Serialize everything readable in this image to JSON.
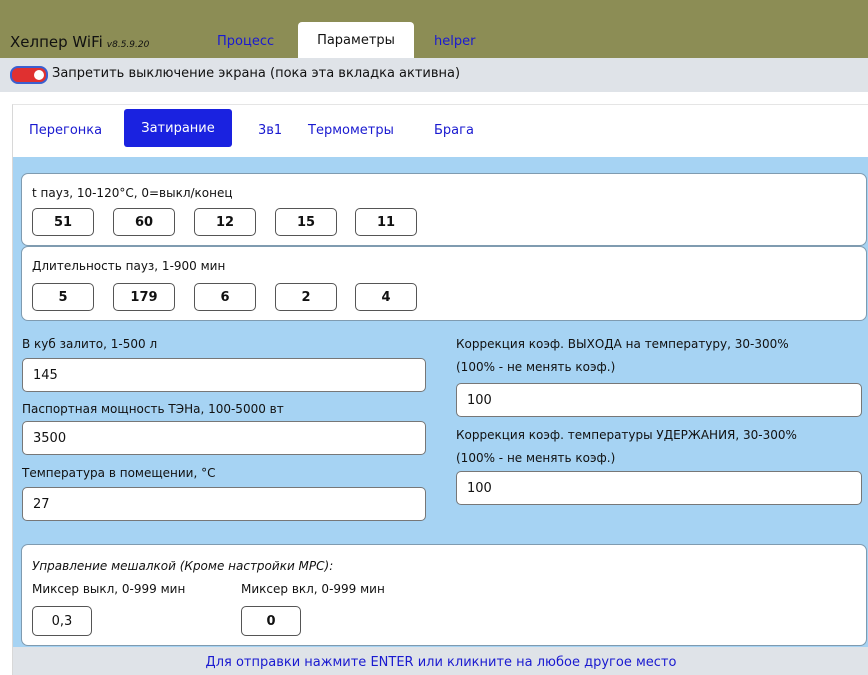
{
  "header": {
    "app_title": "Хелпер WiFi",
    "version": "v8.5.9.20",
    "tabs": [
      {
        "label": "Процесс"
      },
      {
        "label": "Параметры"
      },
      {
        "label": "helper"
      }
    ]
  },
  "screen_lock": {
    "label": "Запретить выключение экрана (пока эта вкладка активна)",
    "enabled": true
  },
  "sub_tabs": [
    {
      "label": "Перегонка"
    },
    {
      "label": "Затирание"
    },
    {
      "label": "3в1"
    },
    {
      "label": "Термометры"
    },
    {
      "label": "Брага"
    }
  ],
  "pause_temps": {
    "label": "t пауз, 10-120°С, 0=выкл/конец",
    "values": [
      "51",
      "60",
      "12",
      "15",
      "11"
    ]
  },
  "pause_durations": {
    "label": "Длительность пауз, 1-900 мин",
    "values": [
      "5",
      "179",
      "6",
      "2",
      "4"
    ]
  },
  "fields": {
    "volume_label": "В куб залито, 1-500 л",
    "volume_value": "145",
    "power_label": "Паспортная мощность ТЭНа, 100-5000 вт",
    "power_value": "3500",
    "room_temp_label": "Температура в помещении, °С",
    "room_temp_value": "27",
    "exit_coef_label_1": "Коррекция коэф. ВЫХОДА на температуру, 30-300%",
    "exit_coef_label_2": "(100% - не менять коэф.)",
    "exit_coef_value": "100",
    "hold_coef_label_1": "Коррекция коэф. температуры УДЕРЖАНИЯ, 30-300%",
    "hold_coef_label_2": "(100% - не менять коэф.)",
    "hold_coef_value": "100"
  },
  "mixer": {
    "title": "Управление мешалкой (Кроме настройки МРС):",
    "off_label": "Миксер выкл, 0-999 мин",
    "off_value": "0,3",
    "on_label": "Миксер вкл, 0-999 мин",
    "on_value": "0"
  },
  "footer": {
    "hint": "Для отправки нажмите ENTER или кликните на любое другое место"
  },
  "colors": {
    "header_bg": "#8c8d55",
    "content_bg": "#a6d3f3",
    "link": "#1a1ad0",
    "active_subtab": "#1a22e0",
    "toggle_on": "#e03030"
  }
}
